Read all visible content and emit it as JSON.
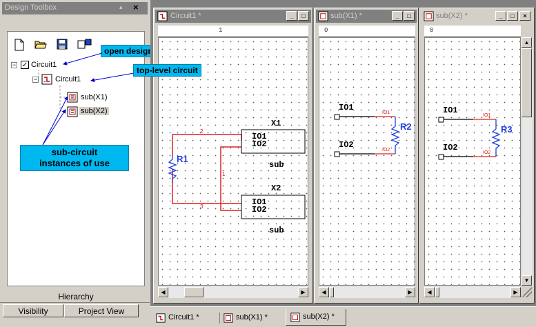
{
  "toolbox": {
    "title": "Design Toolbox",
    "title_buttons": [
      "▴",
      "×"
    ],
    "toolbar_icons": [
      "new-file-icon",
      "open-folder-icon",
      "save-icon",
      "components-icon"
    ],
    "tree": {
      "root": "Circuit1",
      "child": "Circuit1",
      "subs": [
        "sub(X1)",
        "sub(X2)"
      ]
    },
    "annotations": {
      "open_design": "open design",
      "top_level": "top-level circuit",
      "sub_instances_line1": "sub-circuit",
      "sub_instances_line2": "instances of use"
    },
    "hierarchy_label": "Hierarchy",
    "tabs": [
      "Visibility",
      "Project View"
    ]
  },
  "windows": [
    {
      "title": "Circuit1 *",
      "ruler": "1"
    },
    {
      "title": "sub(X1) *",
      "ruler": "0"
    },
    {
      "title": "sub(X2) *",
      "ruler": "0"
    }
  ],
  "circuit1": {
    "components": [
      {
        "name": "X1",
        "type": "sub",
        "pins": [
          "IO1",
          "IO2"
        ]
      },
      {
        "name": "X2",
        "type": "sub",
        "pins": [
          "IO1",
          "IO2"
        ]
      },
      {
        "name": "R1"
      }
    ],
    "wire_labels": [
      "2",
      "1",
      "3"
    ]
  },
  "sub_x1": {
    "pins": [
      "IO1",
      "IO2"
    ],
    "resistor": "R2",
    "pin_tags": [
      "IO1",
      "IO2"
    ]
  },
  "sub_x2": {
    "pins": [
      "IO1",
      "IO2"
    ],
    "resistor": "R3",
    "pin_tags": [
      "IO1",
      "IO2"
    ]
  },
  "bottom_tabs": [
    "Circuit1 *",
    "sub(X1) *",
    "sub(X2) *"
  ],
  "colors": {
    "accent_annotation": "#00b8f0",
    "wire_red": "#e02020",
    "resistor_blue": "#2040e0"
  }
}
